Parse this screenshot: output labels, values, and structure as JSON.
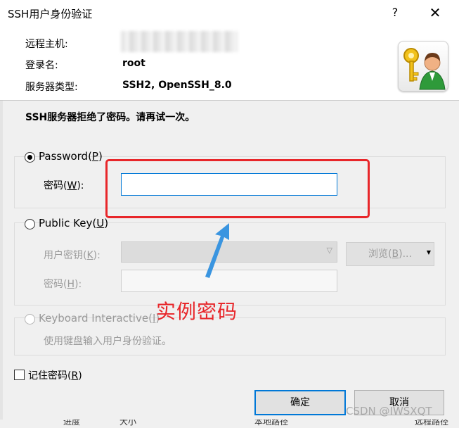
{
  "window": {
    "title": "SSH用户身份验证",
    "help_glyph": "?",
    "close_glyph": "✕"
  },
  "header": {
    "remote_host_label": "远程主机:",
    "username_label": "登录名:",
    "username_value": "root",
    "server_type_label": "服务器类型:",
    "server_type_value": "SSH2, OpenSSH_8.0",
    "logo_icon": "key-user-icon"
  },
  "message": "SSH服务器拒绝了密码。请再试一次。",
  "password_group": {
    "radio_label": "Password(",
    "radio_key": "P",
    "radio_tail": ")",
    "field_label": "密码(",
    "field_key": "W",
    "field_tail": "):",
    "value": ""
  },
  "pubkey_group": {
    "radio_label": "Public Key(",
    "radio_key": "U",
    "radio_tail": ")",
    "key_label": "用户密钥(",
    "key_key": "K",
    "key_tail": "):",
    "passphrase_label": "密码(",
    "passphrase_key": "H",
    "passphrase_tail": "):",
    "browse_label": "浏览(",
    "browse_key": "B",
    "browse_tail": ")..."
  },
  "keyboard_group": {
    "radio_label": "Keyboard Interactive(",
    "radio_key": "I",
    "radio_tail": ")",
    "description": "使用键盘输入用户身份验证。"
  },
  "annotation": {
    "text": "实例密码",
    "color": "#e8262a"
  },
  "remember": {
    "label": "记住密码(",
    "key": "R",
    "tail": ")",
    "checked": false
  },
  "buttons": {
    "ok": "确定",
    "cancel": "取消"
  },
  "watermark": "CSDN @IWSXQT",
  "background_text": [
    "进度",
    "大小",
    "本地路径",
    "远程路径"
  ],
  "colors": {
    "accent": "#0078d7",
    "panel": "#f0f0f0"
  }
}
